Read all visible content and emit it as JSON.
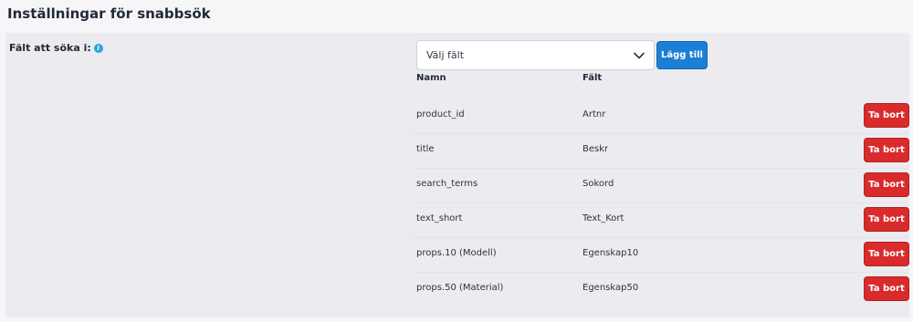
{
  "page": {
    "title": "Inställningar för snabbsök"
  },
  "form": {
    "field_label": "Fält att söka i:",
    "info_icon": "info-icon",
    "select_value": "Välj fält",
    "add_button": "Lägg till"
  },
  "table": {
    "headers": {
      "name": "Namn",
      "field": "Fält"
    },
    "rows": [
      {
        "name": "product_id",
        "field": "Artnr",
        "action": "Ta bort"
      },
      {
        "name": "title",
        "field": "Beskr",
        "action": "Ta bort"
      },
      {
        "name": "search_terms",
        "field": "Sokord",
        "action": "Ta bort"
      },
      {
        "name": "text_short",
        "field": "Text_Kort",
        "action": "Ta bort"
      },
      {
        "name": "props.10 (Modell)",
        "field": "Egenskap10",
        "action": "Ta bort"
      },
      {
        "name": "props.50 (Material)",
        "field": "Egenskap50",
        "action": "Ta bort"
      }
    ]
  },
  "colors": {
    "primary": "#1c7fd6",
    "danger": "#d92b2b",
    "info": "#2aa3e0"
  }
}
